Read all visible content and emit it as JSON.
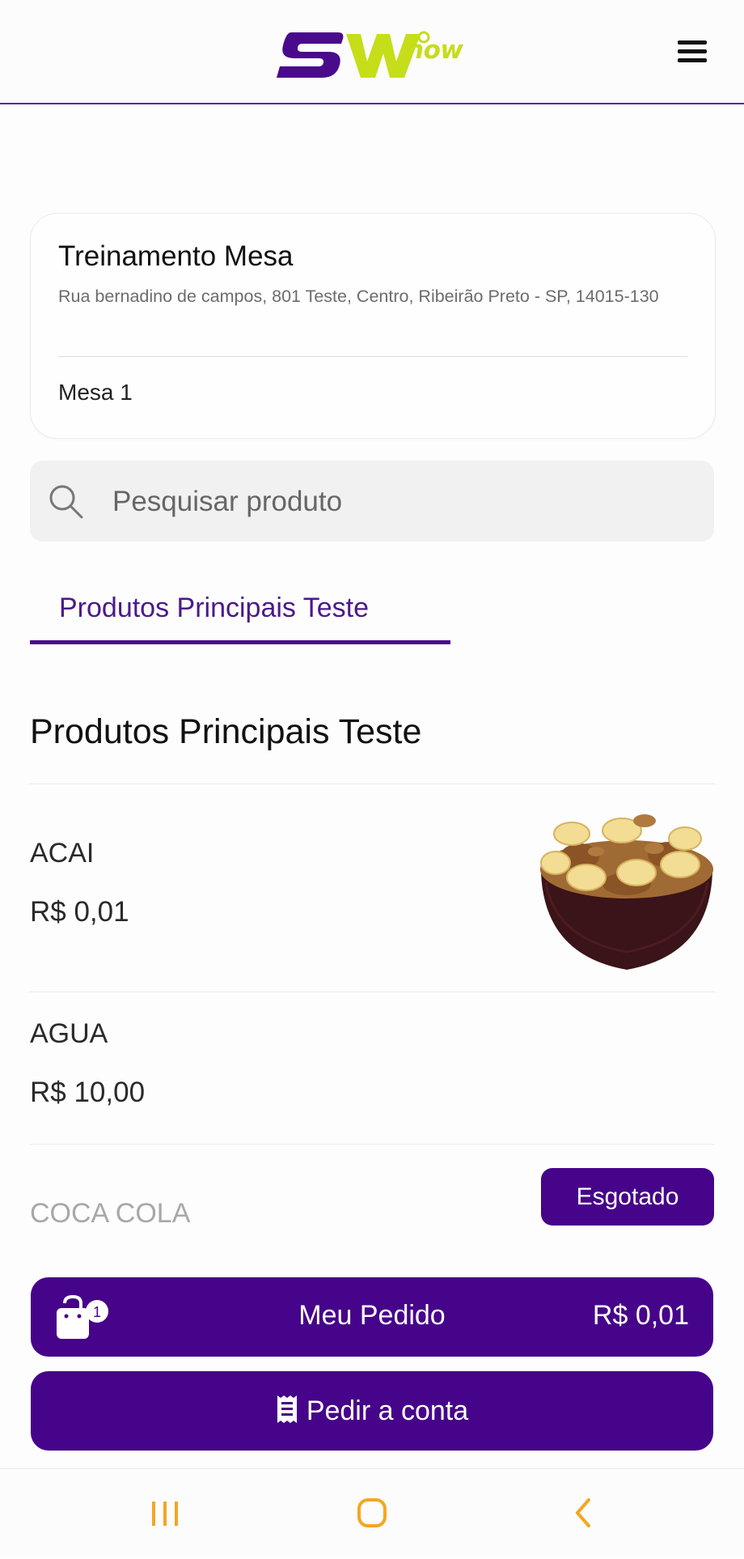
{
  "header": {
    "brand_text": "now",
    "brand_colors": {
      "sw": "#4a0a8c",
      "accent": "#c6dd1a"
    }
  },
  "restaurant": {
    "name": "Treinamento Mesa",
    "address": "Rua bernadino de campos, 801 Teste, Centro, Ribeirão Preto - SP, 14015-130",
    "table": "Mesa 1"
  },
  "search": {
    "placeholder": "Pesquisar produto"
  },
  "tabs": [
    {
      "label": "Produtos Principais Teste",
      "active": true
    }
  ],
  "section": {
    "title": "Produtos Principais Teste"
  },
  "products": [
    {
      "name": "ACAI",
      "price": "R$ 0,01",
      "has_image": true
    },
    {
      "name": "AGUA",
      "price": "R$ 10,00",
      "has_image": false
    },
    {
      "name": "COCA COLA",
      "badge": "Esgotado",
      "sold_out": true
    }
  ],
  "order_bar": {
    "label": "Meu Pedido",
    "total": "R$ 0,01",
    "item_count": "1",
    "icon": "shopping-bag-icon"
  },
  "bill_button": {
    "label": "Pedir a conta",
    "icon": "receipt-icon"
  },
  "nav": {
    "items": [
      "recent-apps-icon",
      "home-icon",
      "back-icon"
    ]
  },
  "colors": {
    "primary": "#46048a",
    "nav_icons": "#f5a623"
  }
}
